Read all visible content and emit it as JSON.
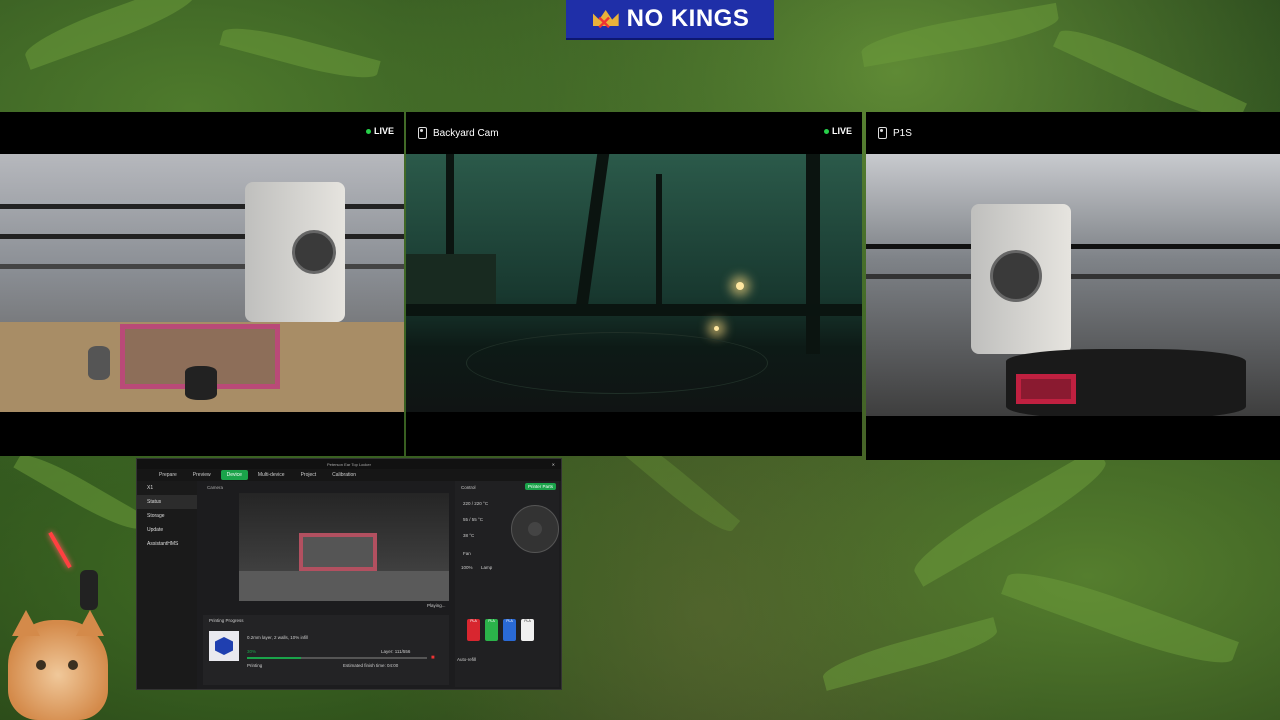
{
  "banner": {
    "text": "NO KINGS"
  },
  "cameras": [
    {
      "title": "",
      "live": "LIVE"
    },
    {
      "title": "Backyard Cam",
      "live": "LIVE"
    },
    {
      "title": "P1S",
      "live": ""
    }
  ],
  "app": {
    "title": "Peterson Ear Top Locker",
    "tabs": [
      "Prepare",
      "Preview",
      "Device",
      "Multi-device",
      "Project",
      "Calibration"
    ],
    "active_tab": "Device",
    "device": "X1",
    "side_items": [
      "Status",
      "Storage",
      "Update",
      "AssistantHMS"
    ],
    "camera_label": "Camera",
    "playing": "Playing...",
    "control_label": "Control",
    "printer_parts_button": "Printer Parts",
    "temps": [
      "220 / 220 °C",
      "55 / 55 °C",
      "38 °C"
    ],
    "fan_label": "Fan",
    "lamp_label": "Lamp",
    "speed": "100%",
    "auto_refill": "Auto-refill",
    "printing_progress_label": "Printing Progress",
    "job_desc": "0.2mm layer, 2 walls, 10% infill",
    "progress_pct": "30%",
    "progress_value": 0.3,
    "status": "Printing",
    "layer": "Layer: 111/556",
    "eta": "Estimated finish time: 04:00",
    "spools": [
      {
        "label": "PLA",
        "color": "#d8262f"
      },
      {
        "label": "PLA",
        "color": "#2bb34a"
      },
      {
        "label": "PLA",
        "color": "#2a6ad6"
      },
      {
        "label": "PLA",
        "color": "#f0f0f0"
      }
    ]
  }
}
